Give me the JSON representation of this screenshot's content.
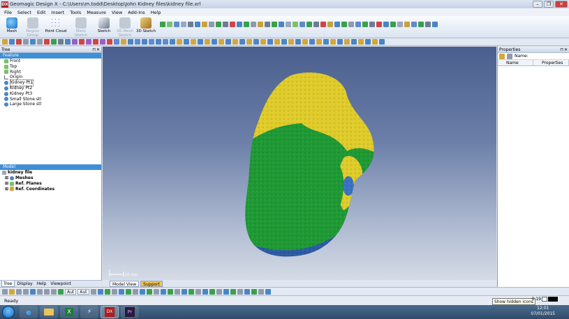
{
  "window": {
    "title": "Geomagic Design X - C:\\Users\\m.todd\\Desktop\\John Kidney files\\kidney file.xrl",
    "logo": "DX"
  },
  "menu": [
    "File",
    "Select",
    "Edit",
    "Insert",
    "Tools",
    "Measure",
    "View",
    "Add-Ins",
    "Help"
  ],
  "ribbon": {
    "buttons": [
      {
        "label": "Mesh",
        "enabled": true,
        "icon": "mesh-icon"
      },
      {
        "label": "Region Group",
        "enabled": false,
        "icon": "region-group-icon"
      },
      {
        "label": "Point Cloud",
        "enabled": true,
        "icon": "point-cloud-icon"
      },
      {
        "label": "Mesh Sketch",
        "enabled": false,
        "icon": "mesh-sketch-icon"
      },
      {
        "label": "Sketch",
        "enabled": true,
        "icon": "sketch-icon"
      },
      {
        "label": "3D Mesh Sketch",
        "enabled": false,
        "icon": "3d-mesh-sketch-icon"
      },
      {
        "label": "3D Sketch",
        "enabled": true,
        "icon": "3d-sketch-icon"
      }
    ]
  },
  "tree": {
    "panel_title": "Tree",
    "feature_header": "Feature",
    "features": [
      {
        "label": "Front",
        "icon": "plane-icon"
      },
      {
        "label": "Top",
        "icon": "plane-icon"
      },
      {
        "label": "Right",
        "icon": "plane-icon"
      },
      {
        "label": "Origin",
        "icon": "origin-icon"
      },
      {
        "label": "Kidney Pt1",
        "icon": "mesh-icon",
        "selected": true
      },
      {
        "label": "Kidney Pt2",
        "icon": "mesh-icon"
      },
      {
        "label": "Kidney Pt3",
        "icon": "mesh-icon"
      },
      {
        "label": "Small Stone stl",
        "icon": "mesh-icon"
      },
      {
        "label": "Large Stone stl",
        "icon": "mesh-icon"
      }
    ],
    "model_header": "Model",
    "model_root": "kidney file",
    "model_items": [
      "Meshes",
      "Ref. Planes",
      "Ref. Coordinates"
    ],
    "tabs": [
      "Tree",
      "Display",
      "Help",
      "Viewpoint"
    ]
  },
  "viewport": {
    "scale_label": "10 mm",
    "tabs": [
      "Model View",
      "Support"
    ]
  },
  "properties": {
    "title": "Properties",
    "name_label": "Name:",
    "columns": [
      "Name",
      "Properties"
    ]
  },
  "bottombar": {
    "combo1": "Aut",
    "combo2": "Aut"
  },
  "status": {
    "text": "Ready",
    "tooltip": "Show hidden icons",
    "zoom": "0.19"
  },
  "taskbar": {
    "time": "12:01",
    "date": "07/01/2015"
  },
  "colors": {
    "yellow": "#e0cc2a",
    "green": "#1f9a34",
    "blue": "#2d5aa4"
  }
}
